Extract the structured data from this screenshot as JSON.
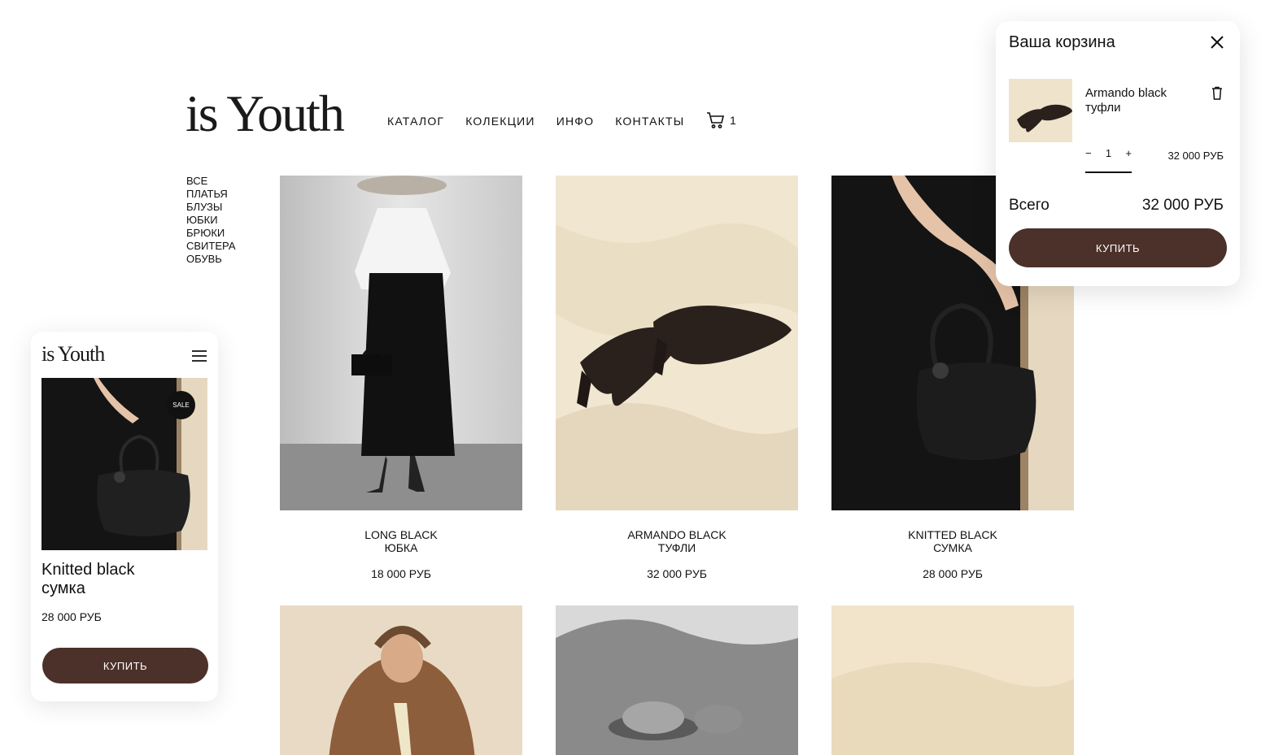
{
  "header": {
    "logo": "is Youth",
    "nav": [
      "КАТАЛОГ",
      "КОЛЕКЦИИ",
      "ИНФО",
      "КОНТАКТЫ"
    ],
    "cart_count": "1"
  },
  "categories": [
    "ВСЕ",
    "ПЛАТЬЯ",
    "БЛУЗЫ",
    "ЮБКИ",
    "БРЮКИ",
    "СВИТЕРА",
    "ОБУВЬ"
  ],
  "products": [
    {
      "name_line1": "LONG BLACK",
      "name_line2": "ЮБКА",
      "price": "18 000 РУБ"
    },
    {
      "name_line1": "ARMANDO BLACK",
      "name_line2": "ТУФЛИ",
      "price": "32 000 РУБ"
    },
    {
      "name_line1": "KNITTED BLACK",
      "name_line2": "СУМКА",
      "price": "28 000 РУБ"
    }
  ],
  "mobile": {
    "logo": "is Youth",
    "badge": "SALE",
    "title_line1": "Knitted black",
    "title_line2": "сумка",
    "price": "28 000 РУБ",
    "buy_label": "КУПИТЬ"
  },
  "cart": {
    "title": "Ваша корзина",
    "item_name_line1": "Armando black",
    "item_name_line2": "туфли",
    "minus": "−",
    "qty": "1",
    "plus": "+",
    "item_price": "32 000 РУБ",
    "total_label": "Всего",
    "total_value": "32 000 РУБ",
    "buy_label": "КУПИТЬ"
  },
  "colors": {
    "accent": "#4b3129"
  }
}
